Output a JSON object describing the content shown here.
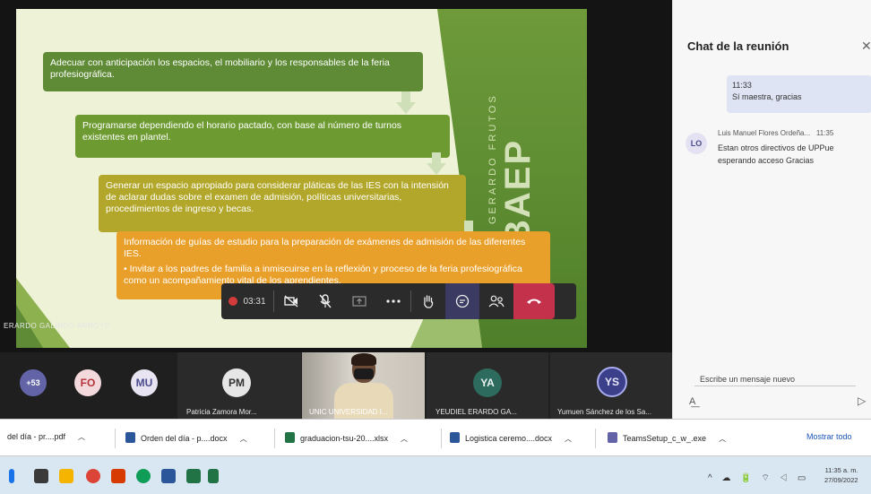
{
  "slide": {
    "brand_big": "COBAEP",
    "brand_small": "GERARDO FRUTOS",
    "box1": "Adecuar con anticipación los espacios, el mobiliario y los responsables de la feria profesiográfica.",
    "box2": "Programarse dependiendo el horario pactado, con base al número de turnos existentes en plantel.",
    "box3": "Generar un espacio apropiado para considerar pláticas de las IES con la intensión de aclarar dudas sobre el examen de admisión, políticas universitarias, procedimientos de ingreso y becas.",
    "box4_line": "Información de guías de estudio para la preparación de exámenes de admisión de las diferentes IES.",
    "box4_bullet": "• Invitar a los padres de familia a inmiscuirse en la reflexión y proceso de la feria profesiográfica como un acompañamiento vital de los aprendientes."
  },
  "presenter_label": "ERARDO GALINDO ARROYO",
  "controls": {
    "timer": "03:31",
    "icons": [
      "record-icon",
      "camera-off-icon",
      "mic-off-icon",
      "share-icon",
      "more-icon",
      "raise-hand-icon",
      "chat-icon",
      "participants-icon",
      "hangup-icon"
    ]
  },
  "participants": {
    "overflow": "+53",
    "tiles": [
      {
        "initials": "FO",
        "name": ""
      },
      {
        "initials": "MU",
        "name": ""
      },
      {
        "initials": "PM",
        "name": "Patricia Zamora Mor..."
      },
      {
        "initials": "",
        "name": "UNIC UNIVERSIDAD I..."
      },
      {
        "initials": "YA",
        "name": "YEUDIEL ERARDO GA..."
      },
      {
        "initials": "YS",
        "name": "Yumuen Sánchez de los Sa..."
      }
    ]
  },
  "chat": {
    "title": "Chat de la reunión",
    "my_message_time": "11:33",
    "my_message_text": "Sí maestra, gracias",
    "msg_avatar": "LO",
    "msg_author": "Luis Manuel Flores Ordeña...",
    "msg_time": "11:35",
    "msg_text": "Estan otros directivos de UPPue esperando acceso Gracias",
    "compose_placeholder": "Escribe un mensaje nuevo"
  },
  "downloads": {
    "items": [
      {
        "name": "del día - pr....pdf"
      },
      {
        "name": "Orden del día - p....docx"
      },
      {
        "name": "graduacion-tsu-20....xlsx"
      },
      {
        "name": "Logistica ceremo....docx"
      },
      {
        "name": "TeamsSetup_c_w_.exe"
      }
    ],
    "show_all": "Mostrar todo"
  },
  "taskbar": {
    "time": "11:35 a. m.",
    "date": "27/09/2022"
  },
  "colors": {
    "hangup": "#c4314b",
    "teams_accent": "#6264a7",
    "box_green": "#5f8b36",
    "box_orange": "#e9a02b"
  }
}
